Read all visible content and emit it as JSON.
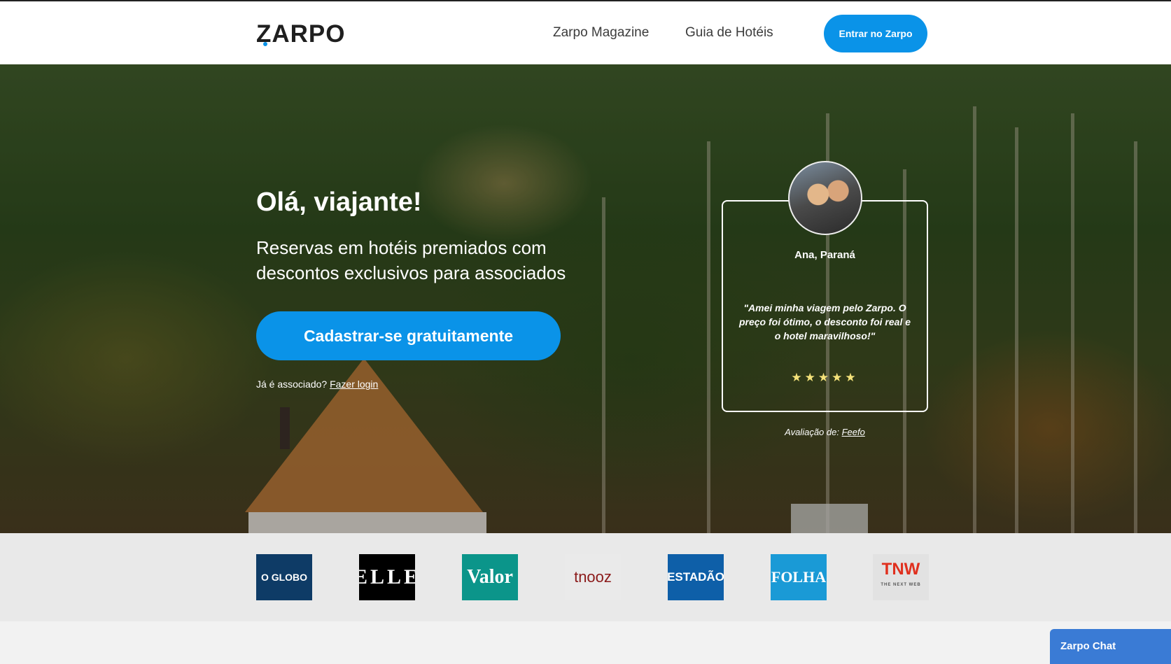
{
  "header": {
    "logo": "ZARPO",
    "nav": [
      {
        "label": "Zarpo Magazine"
      },
      {
        "label": "Guia de Hotéis"
      }
    ],
    "enter_button": "Entrar no Zarpo"
  },
  "hero": {
    "title": "Olá, viajante!",
    "subtitle": "Reservas em hotéis premiados com descontos exclusivos para associados",
    "signup_button": "Cadastrar-se gratuitamente",
    "login_prompt": "Já é associado?",
    "login_link": "Fazer login"
  },
  "review": {
    "reviewer": "Ana, Paraná",
    "quote": "\"Amei minha viagem pelo Zarpo. O preço foi ótimo, o desconto foi real e o hotel maravilhoso!\"",
    "stars": "★★★★★",
    "rating_value": 5,
    "source_label": "Avaliação de:",
    "source_link": "Feefo"
  },
  "press": [
    {
      "name": "O GLOBO"
    },
    {
      "name": "ELLE"
    },
    {
      "name": "Valor"
    },
    {
      "name": "tnooz"
    },
    {
      "name": "ESTADÃO"
    },
    {
      "name": "FOLHA"
    },
    {
      "name": "TNW",
      "tagline": "THE NEXT WEB"
    }
  ],
  "chat": {
    "label": "Zarpo Chat"
  },
  "colors": {
    "accent": "#0a93e8",
    "chat": "#3a7bd5",
    "stars": "#f4e27a"
  }
}
